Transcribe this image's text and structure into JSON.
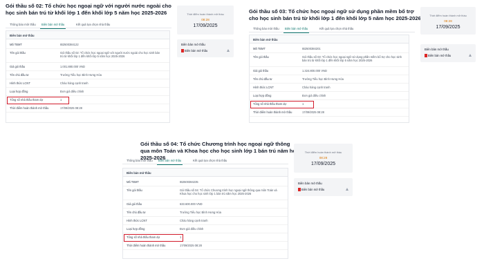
{
  "common": {
    "tabs": [
      "Thông báo mời thầu",
      "Biên bản mở thầu",
      "Kết quả lựa chọn nhà thầu"
    ],
    "info_header": "Biên bản mở thầu",
    "row_labels": [
      "Mã TBMT",
      "Tên gói thầu",
      "Giá gói thầu",
      "Tên chủ đầu tư",
      "Hình thức LCNT",
      "Loại hợp đồng",
      "Tổng số nhà thầu tham dự",
      "Thời điểm hoàn thành mở thầu"
    ],
    "side_label": "Thời điểm hoàn thành mở thầu",
    "side_time": "08:28",
    "side_date": "17/09/2025",
    "doc_title": "Biên bản mở thầu",
    "doc_file": "Biên bản mở thầu"
  },
  "panels": [
    {
      "title": "Gói thầu số 02: Tổ chức học ngoại ngữ với người nước ngoài cho học sinh bán trú từ khối lớp 1 đến khối lớp 5 năm học 2025-2026",
      "values": [
        "IB2500384122",
        "Gói thầu số 02: Tổ chức học ngoại ngữ với người nước ngoài cho học sinh bán trú từ khối lớp 1 đến khối lớp 5 năm học 2025-2026",
        "1.001.880.000 VND",
        "Trường Tiểu học Bình Hưng Hòa",
        "Chào hàng cạnh tranh",
        "Đơn giá điều chỉnh",
        "1",
        "17/09/2025 08:28"
      ]
    },
    {
      "title": "Gói thầu số 03: Tổ chức học ngoại ngữ sử dụng phần mềm bổ trợ cho học sinh bán trú từ khối lớp 1 đến khối lớp 5 năm học 2025-2026",
      "values": [
        "IB2500384201",
        "Gói thầu số 03: Tổ chức học ngoại ngữ sử dụng phần mềm bổ trợ cho học sinh bán trú từ khối lớp 1 đến khối lớp 5 năm học 2025-2026",
        "1.324.800.000 VND",
        "Trường Tiểu học Bình Hưng Hòa",
        "Chào hàng cạnh tranh",
        "Đơn giá điều chỉnh",
        "1",
        "17/09/2025 08:28"
      ]
    },
    {
      "title": "Gói thầu số 04: Tổ chức Chương trình học ngoại ngữ thông qua môn Toán và Khoa học cho học sinh lớp 1 bán trú năm học 2025-2026",
      "values": [
        "IB2500384235",
        "Gói thầu số 04: Tổ chức Chương trình học ngoại ngữ thông qua môn Toán và Khoa học cho học sinh lớp 1 bán trú năm học 2025-2026",
        "633.600.000 VND",
        "Trường Tiểu học Bình Hưng Hòa",
        "Chào hàng cạnh tranh",
        "Đơn giá điều chỉnh",
        "1",
        "17/09/2025 08:28"
      ]
    }
  ]
}
